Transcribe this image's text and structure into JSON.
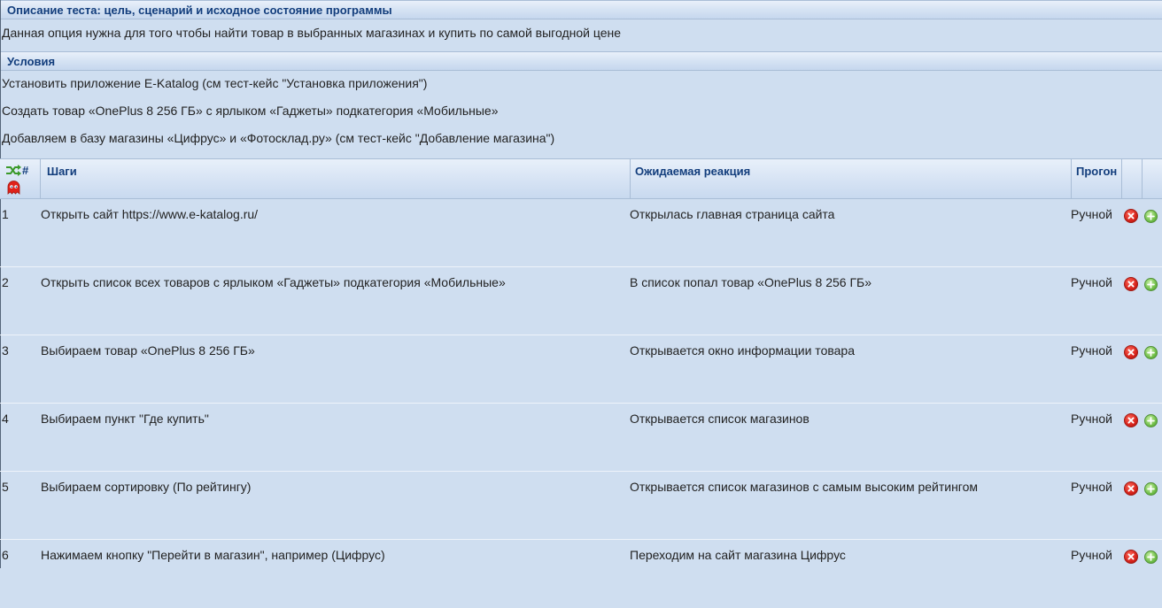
{
  "description": {
    "header": "Описание теста: цель, сценарий и исходное состояние программы",
    "text": "Данная опция нужна для того чтобы найти товар в выбранных магазинах и купить по самой выгодной цене"
  },
  "conditions": {
    "header": "Условия",
    "lines": [
      "Установить приложение E-Katalog (см тест-кейс \"Установка приложения\")",
      "Создать товар «OnePlus 8 256 ГБ» с ярлыком «Гаджеты» подкатегория «Мобильные»",
      "Добавляем в базу магазины «Цифрус» и «Фотосклад.ру» (см тест-кейс \"Добавление магазина\")"
    ]
  },
  "steps_table": {
    "headers": {
      "num": "#",
      "steps": "Шаги",
      "expected": "Ожидаемая реакция",
      "run": "Прогон"
    },
    "icons": {
      "shuffle": "shuffle-icon",
      "ghost": "ghost-icon",
      "delete": "delete-icon",
      "add": "add-icon"
    },
    "rows": [
      {
        "num": "1",
        "step": "Открыть сайт https://www.e-katalog.ru/",
        "expected": "Открылась главная страница сайта",
        "run": "Ручной"
      },
      {
        "num": "2",
        "step": "Открыть список всех товаров с ярлыком «Гаджеты» подкатегория «Мобильные»",
        "expected": "В список попал товар «OnePlus 8 256 ГБ»",
        "run": "Ручной"
      },
      {
        "num": "3",
        "step": "Выбираем товар «OnePlus 8 256 ГБ»",
        "expected": "Открывается окно информации товара",
        "run": "Ручной"
      },
      {
        "num": "4",
        "step": "Выбираем пункт \"Где купить\"",
        "expected": "Открывается список магазинов",
        "run": "Ручной"
      },
      {
        "num": "5",
        "step": "Выбираем сортировку (По рейтингу)",
        "expected": "Открывается список магазинов с самым высоким рейтингом",
        "run": "Ручной"
      },
      {
        "num": "6",
        "step": "Нажимаем кнопку \"Перейти в магазин\", например (Цифрус)",
        "expected": "Переходим на сайт магазина Цифрус",
        "run": "Ручной"
      }
    ]
  },
  "colors": {
    "background": "#cfdef0",
    "header_text": "#123d7c",
    "delete": "#d6221a",
    "add": "#72c04a"
  }
}
